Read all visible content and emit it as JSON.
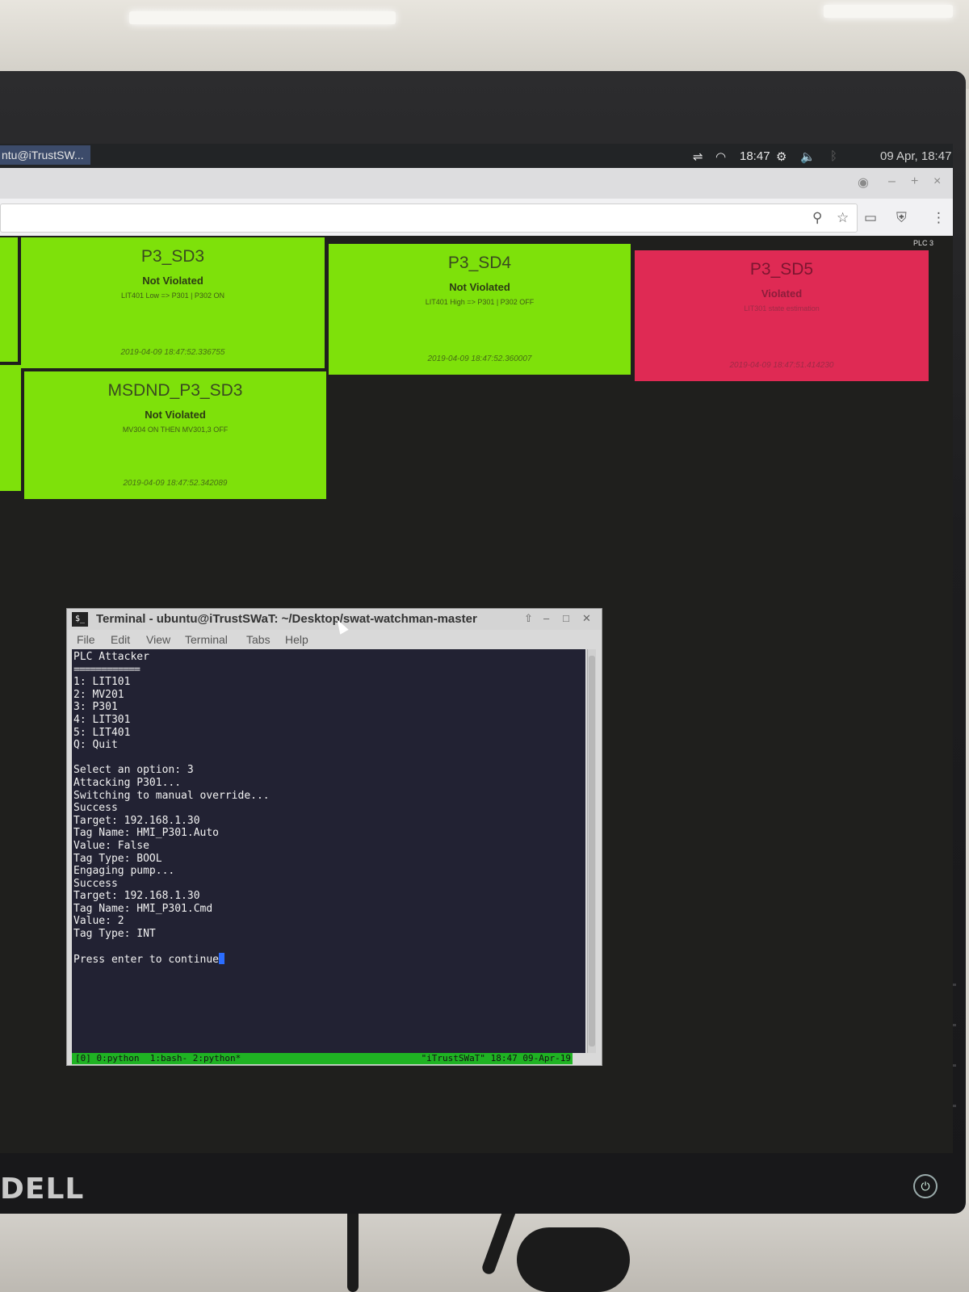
{
  "taskbar": {
    "active_task": "ntu@iTrustSW...",
    "clock": "18:47",
    "date": "09 Apr, 18:47"
  },
  "browser": {
    "window_controls": [
      "–",
      "+",
      "×"
    ]
  },
  "dashboard": {
    "plc_label": "PLC 3",
    "tiles": [
      {
        "name": "P3_SD3",
        "status": "Not Violated",
        "desc": "LIT401 Low => P301 | P302 ON",
        "time": "2019-04-09 18:47:52.336755",
        "state": "green"
      },
      {
        "name": "P3_SD4",
        "status": "Not Violated",
        "desc": "LIT401 High => P301 | P302 OFF",
        "time": "2019-04-09 18:47:52.360007",
        "state": "green"
      },
      {
        "name": "P3_SD5",
        "status": "Violated",
        "desc": "LIT301 state estimation",
        "time": "2019-04-09 18:47:51.414230",
        "state": "red"
      },
      {
        "name": "MSDND_P3_SD3",
        "status": "Not Violated",
        "desc": "MV304 ON THEN MV301,3 OFF",
        "time": "2019-04-09 18:47:52.342089",
        "state": "green"
      }
    ],
    "colors": {
      "ok": "#7ee10a",
      "violated": "#df2a54"
    }
  },
  "terminal": {
    "title": "Terminal - ubuntu@iTrustSWaT: ~/Desktop/swat-watchman-master",
    "menu": [
      "File",
      "Edit",
      "View",
      "Terminal",
      "Tabs",
      "Help"
    ],
    "header": "PLC Attacker",
    "separator": "============",
    "options": [
      "1: LIT101",
      "2: MV201",
      "3: P301",
      "4: LIT301",
      "5: LIT401",
      "Q: Quit"
    ],
    "output": [
      "Select an option: 3",
      "Attacking P301...",
      "Switching to manual override...",
      "Success",
      "Target: 192.168.1.30",
      "Tag Name: HMI_P301.Auto",
      "Value: False",
      "Tag Type: BOOL",
      "Engaging pump...",
      "Success",
      "Target: 192.168.1.30",
      "Tag Name: HMI_P301.Cmd",
      "Value: 2",
      "Tag Type: INT"
    ],
    "prompt": "Press enter to continue",
    "tmux_left": "[0] 0:python  1:bash- 2:python*",
    "tmux_right": "\"iTrustSWaT\" 18:47 09-Apr-19"
  },
  "monitor": {
    "brand": "DELL"
  }
}
